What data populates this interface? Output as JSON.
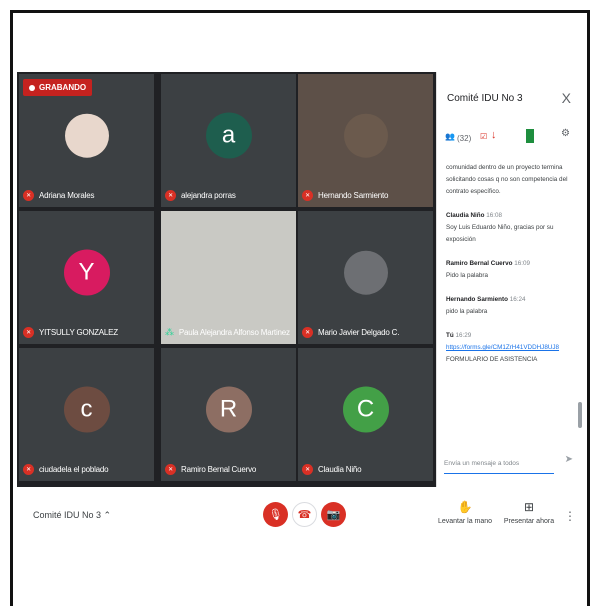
{
  "recording": {
    "label": "GRABANDO"
  },
  "tiles": [
    {
      "name": "Adriana Morales",
      "initial": "",
      "color": "#e8d7cc",
      "photo": true
    },
    {
      "name": "alejandra porras",
      "initial": "a",
      "color": "#1e5e4e"
    },
    {
      "name": "Hernando Sarmiento",
      "initial": "",
      "color": "#6b5a4d",
      "photo": true
    },
    {
      "name": "YITSULLY GONZALEZ",
      "initial": "Y",
      "color": "#d81b60"
    },
    {
      "name": "Paula Alejandra Alfonso Martinez",
      "initial": "",
      "color": "#c9c9c4",
      "photo": true
    },
    {
      "name": "Mario Javier Delgado C.",
      "initial": "",
      "color": "#6d6f73",
      "photo": true
    },
    {
      "name": "ciudadela el poblado",
      "initial": "c",
      "color": "#6d4c41"
    },
    {
      "name": "Ramiro Bernal Cuervo",
      "initial": "R",
      "color": "#8d6e63"
    },
    {
      "name": "Claudia Niño",
      "initial": "C",
      "color": "#43a047"
    }
  ],
  "panel": {
    "title": "Comité IDU No 3",
    "close": "X",
    "people_count": "(32)",
    "messages": [
      {
        "sender": "",
        "time": "",
        "text": "comunidad dentro de un proyecto termina solicitando cosas q no son competencia del contrato específico."
      },
      {
        "sender": "Claudia Niño",
        "time": "16:08",
        "text": "Soy Luis Eduardo Niño, gracias por su exposición"
      },
      {
        "sender": "Ramiro Bernal Cuervo",
        "time": "16:09",
        "text": "Pido la palabra"
      },
      {
        "sender": "Hernando Sarmiento",
        "time": "16:24",
        "text": "pido la palabra"
      },
      {
        "sender": "Tú",
        "time": "16:29",
        "link": "https://forms.gle/CM1ZrH41VDDHJ8UJ8",
        "text": "FORMULARIO DE ASISTENCIA"
      }
    ],
    "input_placeholder": "Envía un mensaje a todos"
  },
  "bottom": {
    "meeting_name": "Comité IDU No 3",
    "raise_hand": "Levantar la mano",
    "present": "Presentar ahora"
  }
}
